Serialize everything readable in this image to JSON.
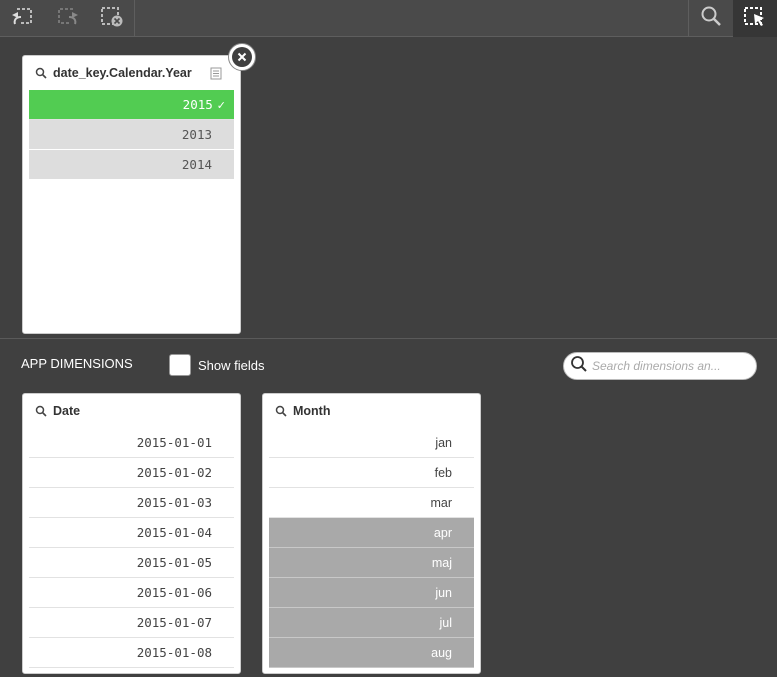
{
  "toolbar": {
    "buttons": [
      {
        "icon": "step-back-icon"
      },
      {
        "icon": "step-forward-icon"
      },
      {
        "icon": "clear-all-selections-icon"
      },
      {
        "icon": "search-icon"
      },
      {
        "icon": "selections-tool-icon"
      }
    ]
  },
  "selection_listbox": {
    "title": "date_key.Calendar.Year",
    "rows": [
      {
        "value": "2015",
        "state": "selected",
        "check": "✓"
      },
      {
        "value": "2013",
        "state": "alternative"
      },
      {
        "value": "2014",
        "state": "alternative"
      }
    ]
  },
  "app_dimensions": {
    "label": "APP DIMENSIONS",
    "show_fields_label": "Show fields",
    "search_placeholder": "Search dimensions an..."
  },
  "date_listbox": {
    "title": "Date",
    "rows": [
      "2015-01-01",
      "2015-01-02",
      "2015-01-03",
      "2015-01-04",
      "2015-01-05",
      "2015-01-06",
      "2015-01-07",
      "2015-01-08"
    ]
  },
  "month_listbox": {
    "title": "Month",
    "rows": [
      {
        "value": "jan",
        "state": "possible"
      },
      {
        "value": "feb",
        "state": "possible"
      },
      {
        "value": "mar",
        "state": "possible"
      },
      {
        "value": "apr",
        "state": "excluded"
      },
      {
        "value": "maj",
        "state": "excluded"
      },
      {
        "value": "jun",
        "state": "excluded"
      },
      {
        "value": "jul",
        "state": "excluded"
      },
      {
        "value": "aug",
        "state": "excluded"
      }
    ]
  },
  "colors": {
    "selected": "#52cc52",
    "alternative": "#dddddd",
    "excluded": "#a9a9a9",
    "background": "#404040"
  }
}
